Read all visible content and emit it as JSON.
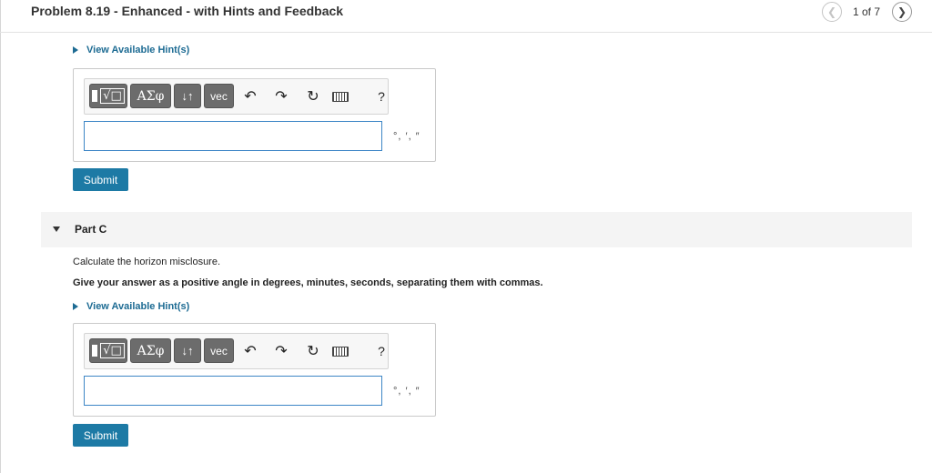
{
  "header": {
    "title": "Problem 8.19 - Enhanced - with Hints and Feedback",
    "pager_text": "1 of 7",
    "prev_icon": "chevron-left-icon",
    "next_icon": "chevron-right-icon"
  },
  "part_b": {
    "hint_link": "View Available Hint(s)",
    "toolbar": {
      "templates_icon": "templates-icon",
      "greek_label": "ΑΣφ",
      "arrows_label": "↓↑",
      "vec_label": "vec",
      "help_label": "?"
    },
    "answer_value": "",
    "format_hint": "°, ′, ″",
    "submit_label": "Submit"
  },
  "part_c": {
    "title": "Part C",
    "question": "Calculate the horizon misclosure.",
    "instruction": "Give your answer as a positive angle in degrees, minutes, seconds, separating them with commas.",
    "hint_link": "View Available Hint(s)",
    "toolbar": {
      "templates_icon": "templates-icon",
      "greek_label": "ΑΣφ",
      "arrows_label": "↓↑",
      "vec_label": "vec",
      "help_label": "?"
    },
    "answer_value": "",
    "format_hint": "°, ′, ″",
    "submit_label": "Submit"
  },
  "colors": {
    "accent": "#1d7aa5",
    "link": "#1d6b93",
    "toolbar_button": "#6c6c6c"
  }
}
